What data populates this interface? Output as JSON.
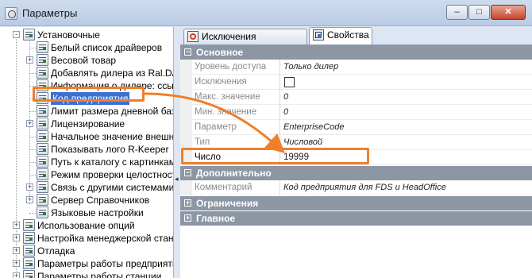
{
  "window": {
    "title": "Параметры",
    "minimize_glyph": "–",
    "maximize_glyph": "□",
    "close_glyph": "✕"
  },
  "tree": {
    "items": [
      {
        "label": "Установочные",
        "level": 0,
        "expander": "-"
      },
      {
        "label": "Белый список драйверов",
        "level": 1,
        "expander": ""
      },
      {
        "label": "Весовой товар",
        "level": 1,
        "expander": "+"
      },
      {
        "label": "Добавлять дилера из Ral.DAT",
        "level": 1,
        "expander": ""
      },
      {
        "label": "Информация о дилере: ссылк",
        "level": 1,
        "expander": ""
      },
      {
        "label": "Код предприятия",
        "level": 1,
        "expander": "",
        "selected": true
      },
      {
        "label": "Лимит размера дневной базы",
        "level": 1,
        "expander": ""
      },
      {
        "label": "Лицензирование",
        "level": 1,
        "expander": "+"
      },
      {
        "label": "Начальное значение внешне",
        "level": 1,
        "expander": ""
      },
      {
        "label": "Показывать лого R-Keeper",
        "level": 1,
        "expander": ""
      },
      {
        "label": "Путь к каталогу с картинкам",
        "level": 1,
        "expander": ""
      },
      {
        "label": "Режим проверки целостност",
        "level": 1,
        "expander": ""
      },
      {
        "label": "Связь с другими системами",
        "level": 1,
        "expander": "+"
      },
      {
        "label": "Сервер Справочников",
        "level": 1,
        "expander": "+"
      },
      {
        "label": "Языковые настройки",
        "level": 1,
        "expander": ""
      },
      {
        "label": "Использование опций",
        "level": 0,
        "expander": "+"
      },
      {
        "label": "Настройка менеджерской станц",
        "level": 0,
        "expander": "+"
      },
      {
        "label": "Отладка",
        "level": 0,
        "expander": "+"
      },
      {
        "label": "Параметры работы предприятия",
        "level": 0,
        "expander": "+"
      },
      {
        "label": "Параметры работы станции",
        "level": 0,
        "expander": "+"
      }
    ]
  },
  "splitter": {
    "arrow": "◂"
  },
  "tabs": [
    {
      "label": "Исключения параметров",
      "icon": "gear-icon",
      "active": false
    },
    {
      "label": "Свойства",
      "icon": "properties-icon",
      "active": true
    }
  ],
  "categories": {
    "main": {
      "label": "Основное",
      "expander": "−"
    },
    "extra": {
      "label": "Дополнительно",
      "expander": "−"
    },
    "limits": {
      "label": "Ограничения",
      "expander": "+"
    },
    "general": {
      "label": "Главное",
      "expander": "+"
    }
  },
  "properties": {
    "access_level": {
      "name": "Уровень доступа",
      "value": "Только дилер"
    },
    "exceptions": {
      "name": "Исключения",
      "checked": false
    },
    "max_value": {
      "name": "Макс. значение",
      "value": "0"
    },
    "min_value": {
      "name": "Мин. значение",
      "value": "0"
    },
    "parameter": {
      "name": "Параметр",
      "value": "EnterpriseCode"
    },
    "type": {
      "name": "Тип",
      "value": "Числовой"
    },
    "number": {
      "name": "Число",
      "value": "19999"
    },
    "comment": {
      "name": "Комментарий",
      "value": "Код предприятия для FDS и HeadOffice"
    }
  },
  "colors": {
    "highlight": "#ef7f2b",
    "category_bg": "#8d96a3",
    "selection": "#3d6fd1"
  }
}
